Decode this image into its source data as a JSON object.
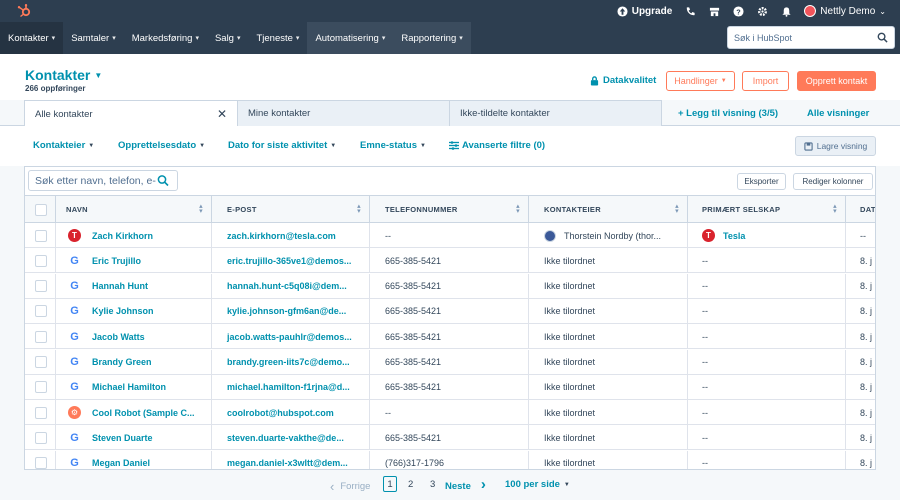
{
  "topbar": {
    "upgrade_label": "Upgrade",
    "account_name": "Nettly Demo",
    "icons": [
      "upgrade-icon",
      "calling-icon",
      "marketplace-icon",
      "help-icon",
      "settings-icon",
      "notifications-icon"
    ]
  },
  "nav": {
    "items": [
      {
        "label": "Kontakter",
        "caret": "▾"
      },
      {
        "label": "Samtaler",
        "caret": "▾"
      },
      {
        "label": "Markedsføring",
        "caret": "▾"
      },
      {
        "label": "Salg",
        "caret": "▾"
      },
      {
        "label": "Tjeneste",
        "caret": "▾"
      },
      {
        "label": "Automatisering",
        "caret": "▾"
      },
      {
        "label": "Rapportering",
        "caret": "▾"
      }
    ],
    "search_placeholder": "Søk i HubSpot"
  },
  "header": {
    "title": "Kontakter",
    "subtitle": "266 oppføringer",
    "data_quality": "Datakvalitet",
    "actions_label": "Handlinger",
    "import_label": "Import",
    "create_label": "Opprett kontakt"
  },
  "tabs": {
    "items": [
      "Alle kontakter",
      "Mine kontakter",
      "Ikke-tildelte kontakter"
    ],
    "add_view": "+ Legg til visning (3/5)",
    "all_views": "Alle visninger"
  },
  "filters": {
    "items": [
      "Kontakteier",
      "Opprettelsesdato",
      "Dato for siste aktivitet",
      "Emne-status"
    ],
    "advanced": "Avanserte filtre (0)",
    "save_view": "Lagre visning"
  },
  "table": {
    "search_placeholder": "Søk etter navn, telefon, e-",
    "export_label": "Eksporter",
    "edit_columns_label": "Rediger kolonner",
    "columns": [
      "NAVN",
      "E-POST",
      "TELEFONNUMMER",
      "KONTAKTEIER",
      "PRIMÆRT SELSKAP",
      "DAT"
    ],
    "rows": [
      {
        "name": "Zach Kirkhorn",
        "email": "zach.kirkhorn@tesla.com",
        "phone": "--",
        "owner": "Thorstein Nordby (thor...",
        "company": "Tesla",
        "date": "--",
        "icon": "tesla-logo"
      },
      {
        "name": "Eric Trujillo",
        "email": "eric.trujillo-365ve1@demos...",
        "phone": "665-385-5421",
        "owner": "Ikke tilordnet",
        "company": "--",
        "date": "8. j",
        "icon": "google-logo"
      },
      {
        "name": "Hannah Hunt",
        "email": "hannah.hunt-c5q08i@dem...",
        "phone": "665-385-5421",
        "owner": "Ikke tilordnet",
        "company": "--",
        "date": "8. j",
        "icon": "google-logo"
      },
      {
        "name": "Kylie Johnson",
        "email": "kylie.johnson-gfm6an@de...",
        "phone": "665-385-5421",
        "owner": "Ikke tilordnet",
        "company": "--",
        "date": "8. j",
        "icon": "google-logo"
      },
      {
        "name": "Jacob Watts",
        "email": "jacob.watts-pauhlr@demos...",
        "phone": "665-385-5421",
        "owner": "Ikke tilordnet",
        "company": "--",
        "date": "8. j",
        "icon": "google-logo"
      },
      {
        "name": "Brandy Green",
        "email": "brandy.green-iits7c@demo...",
        "phone": "665-385-5421",
        "owner": "Ikke tilordnet",
        "company": "--",
        "date": "8. j",
        "icon": "google-logo"
      },
      {
        "name": "Michael Hamilton",
        "email": "michael.hamilton-f1rjna@d...",
        "phone": "665-385-5421",
        "owner": "Ikke tilordnet",
        "company": "--",
        "date": "8. j",
        "icon": "google-logo"
      },
      {
        "name": "Cool Robot (Sample C...",
        "email": "coolrobot@hubspot.com",
        "phone": "--",
        "owner": "Ikke tilordnet",
        "company": "--",
        "date": "8. j",
        "icon": "hubspot-logo"
      },
      {
        "name": "Steven Duarte",
        "email": "steven.duarte-vakthe@de...",
        "phone": "665-385-5421",
        "owner": "Ikke tilordnet",
        "company": "--",
        "date": "8. j",
        "icon": "google-logo"
      },
      {
        "name": "Megan Daniel",
        "email": "megan.daniel-x3wltt@dem...",
        "phone": "(766)317-1796",
        "owner": "Ikke tilordnet",
        "company": "--",
        "date": "8. j",
        "icon": "google-logo"
      }
    ]
  },
  "pager": {
    "prev": "Forrige",
    "pages": [
      "1",
      "2",
      "3"
    ],
    "current": "1",
    "next": "Neste",
    "per_page": "100 per side"
  },
  "colors": {
    "nav_bg": "#2d3e50",
    "link": "#0091ae",
    "accent": "#ff7a59",
    "text": "#33475b"
  }
}
